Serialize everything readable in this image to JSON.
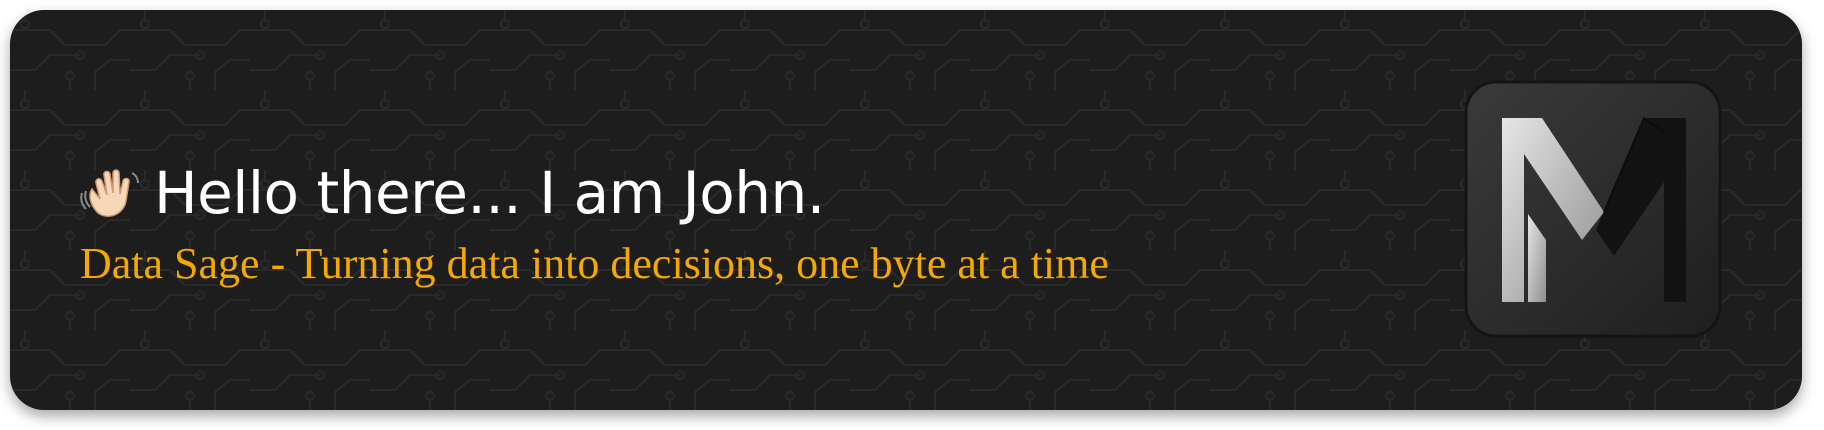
{
  "banner": {
    "greeting_icon": "waving-hand-icon",
    "headline": "Hello there... I am John.",
    "tagline": "Data Sage - Turning data into decisions, one byte at a time",
    "logo_icon": "m-monogram-logo"
  },
  "colors": {
    "background": "#1d1d1d",
    "headline": "#ffffff",
    "tagline": "#f4a800"
  }
}
